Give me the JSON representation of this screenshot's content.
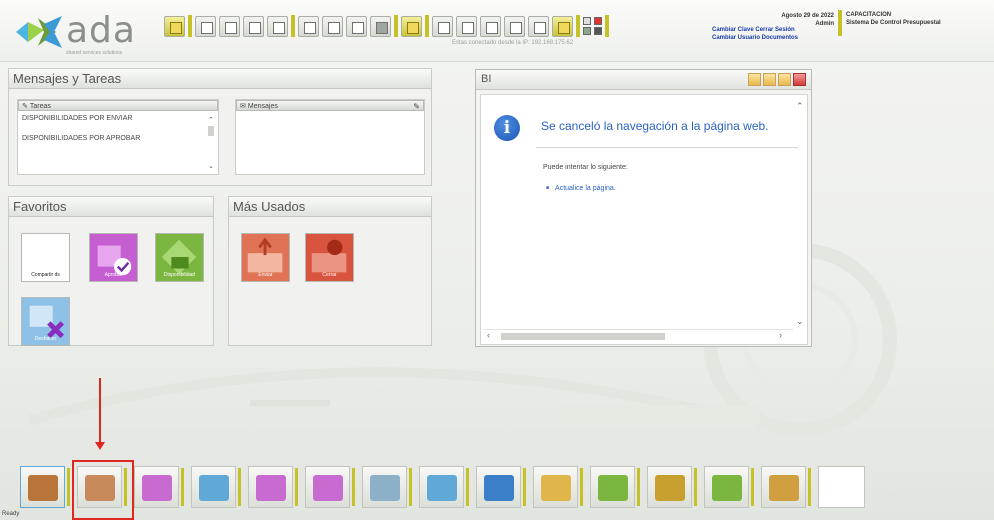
{
  "app": {
    "logo_text": "ada",
    "logo_tagline": "shared services solutions",
    "connection_text": "Estas conectado desde la IP: 192.168.175.62"
  },
  "header": {
    "date": "Agosto 29 de 2022",
    "user": "Admin",
    "company": "CAPACITACION",
    "system_name": "Sistema De Control Presupuestal",
    "links": {
      "change_password": "Cambiar Clave",
      "logout": "Cerrar Sesión",
      "change_doc_user": "Cambiar Usuario Documentos"
    }
  },
  "messages_panel": {
    "title": "Mensajes y Tareas",
    "tasks_header": "Tareas",
    "messages_header": "Mensajes",
    "tasks": [
      "DISPONIBILIDADES POR ENVIAR",
      "DISPONIBILIDADES POR APROBAR"
    ]
  },
  "favorites_panel": {
    "title": "Favoritos",
    "tiles": [
      {
        "label": "Compartir ds"
      },
      {
        "label": "Aprobar"
      },
      {
        "label": "Disponibilidad"
      },
      {
        "label": "Deshacer"
      }
    ]
  },
  "most_used_panel": {
    "title": "Más Usados",
    "tiles": [
      {
        "label": "Enviar"
      },
      {
        "label": "Cerrar"
      }
    ]
  },
  "bi_window": {
    "title": "BI",
    "message_title": "Se canceló la navegación a la página web.",
    "hint": "Puede intentar lo siguiente:",
    "action_link": "Actualice la página."
  },
  "dock": {
    "item_count": 16,
    "highlighted_index": 1
  },
  "status_bar": {
    "text": "Ready"
  },
  "colors": {
    "accent_yellow": "#c5c227",
    "link_blue": "#1a3aa8",
    "info_blue": "#2a63c2",
    "highlight_red": "#e0271f"
  }
}
